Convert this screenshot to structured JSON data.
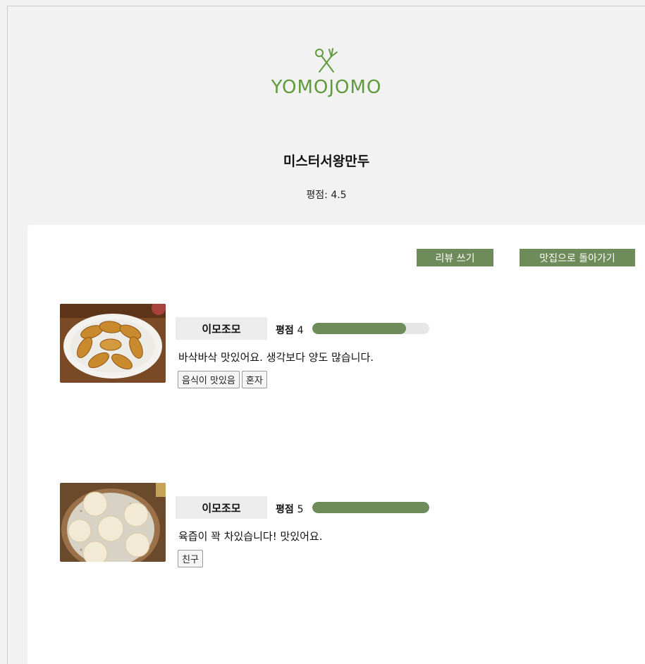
{
  "header": {
    "logo_icon": "fork-spoon-icon",
    "logo_text": "YOMOJOMO",
    "brand_color": "#5f9b3d"
  },
  "store": {
    "name": "미스터서왕만두",
    "rating_text": "평점: 4.5"
  },
  "actions": {
    "write_review": "리뷰 쓰기",
    "back_to_restaurants": "맛집으로 돌아가기",
    "button_color": "#6e8c5a"
  },
  "reviews": [
    {
      "user": "이모조모",
      "rating_label": "평점",
      "rating": 4,
      "rating_max": 5,
      "text": "바삭바삭 맛있어요. 생각보다 양도 많습니다.",
      "tags": [
        "음식이 맛있음",
        "혼자"
      ],
      "photo": "fried-dumplings-photo"
    },
    {
      "user": "이모조모",
      "rating_label": "평점",
      "rating": 5,
      "rating_max": 5,
      "text": "육즙이 꽉 차있습니다! 맛있어요.",
      "tags": [
        "친구"
      ],
      "photo": "steamed-dumplings-photo"
    }
  ]
}
